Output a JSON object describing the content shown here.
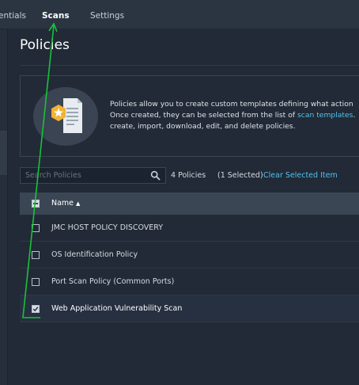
{
  "topnav": {
    "items": [
      {
        "label": "entials",
        "active": false
      },
      {
        "label": "Scans",
        "active": true
      },
      {
        "label": "Settings",
        "active": false
      }
    ]
  },
  "page": {
    "title": "Policies"
  },
  "info": {
    "line1": "Policies allow you to create custom templates defining what action",
    "line2_prefix": "Once created, they can be selected from the list of ",
    "line2_link": "scan templates",
    "line2_suffix": ".",
    "line3": "create, import, download, edit, and delete policies.",
    "illustration_icon": "policy-document-star-icon"
  },
  "search": {
    "placeholder": "Search Policies",
    "value": "",
    "icon": "search-icon"
  },
  "summary": {
    "count": "4 Policies",
    "selected": "(1 Selected)",
    "clear_label": "Clear Selected Item"
  },
  "table": {
    "header": {
      "name": "Name",
      "sort_icon": "▲"
    },
    "rows": [
      {
        "name": "JMC HOST POLICY DISCOVERY",
        "checked": false
      },
      {
        "name": "OS Identification Policy",
        "checked": false
      },
      {
        "name": "Port Scan Policy (Common Ports)",
        "checked": false
      },
      {
        "name": "Web Application Vulnerability Scan",
        "checked": true
      }
    ]
  },
  "colors": {
    "accent_link": "#4fc3f0",
    "annotation": "#18c23a",
    "badge_gold": "#f2b233"
  }
}
